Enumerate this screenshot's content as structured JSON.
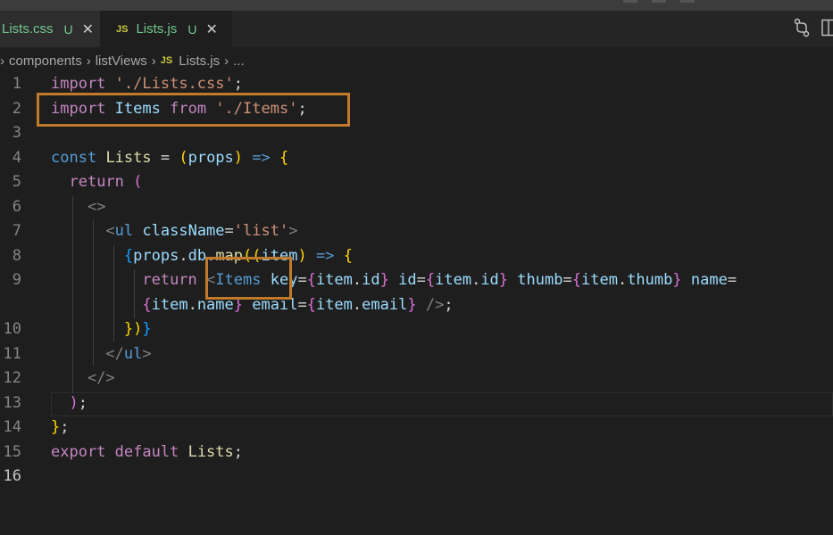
{
  "tabs": [
    {
      "title": "Lists.css",
      "status": "U",
      "close": "✕",
      "active": false
    },
    {
      "icon": "JS",
      "title": "Lists.js",
      "status": "U",
      "close": "✕",
      "active": true
    }
  ],
  "breadcrumbs": {
    "items": [
      "components",
      "listViews"
    ],
    "file_icon": "JS",
    "file": "Lists.js",
    "ellipsis": "..."
  },
  "editor": {
    "current_line": 16,
    "lines": [
      {
        "n": "1"
      },
      {
        "n": "2"
      },
      {
        "n": "3"
      },
      {
        "n": "4"
      },
      {
        "n": "5"
      },
      {
        "n": "6"
      },
      {
        "n": "7"
      },
      {
        "n": "8"
      },
      {
        "n": "9"
      },
      {
        "n": ""
      },
      {
        "n": "10"
      },
      {
        "n": "11"
      },
      {
        "n": "12"
      },
      {
        "n": "13"
      },
      {
        "n": "14"
      },
      {
        "n": "15"
      },
      {
        "n": "16"
      }
    ]
  },
  "colors": {
    "background": "#1e1e1e",
    "highlight": "#c07a2a",
    "untracked": "#73c991"
  },
  "icons": [
    "close-icon",
    "source-control-icon",
    "split-editor-icon",
    "js-file-icon",
    "chevron-right-icon"
  ]
}
